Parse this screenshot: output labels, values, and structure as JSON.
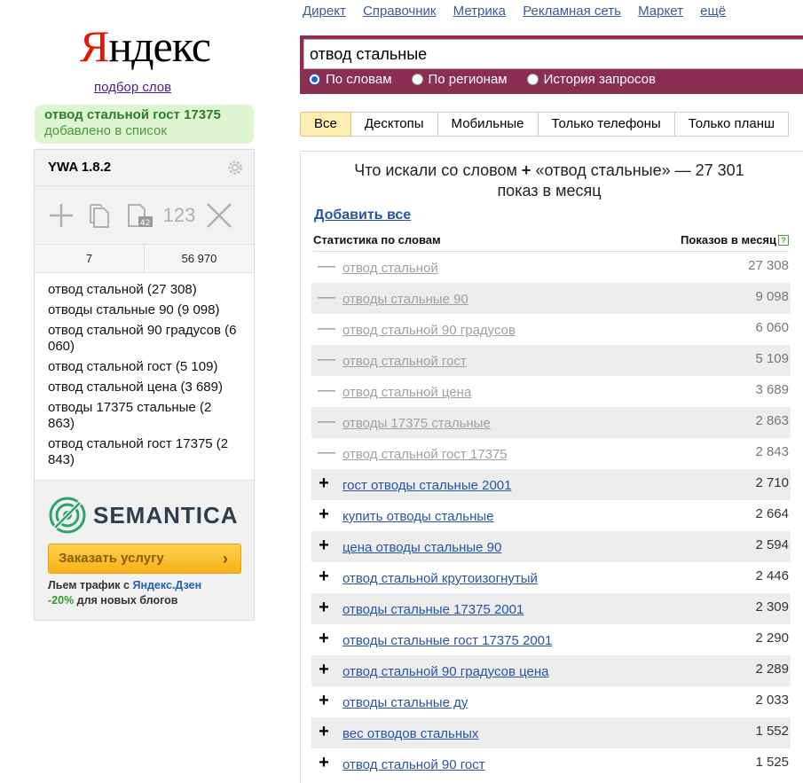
{
  "logo": {
    "first": "Я",
    "rest": "ндекс"
  },
  "podbor_link": "подбор слов",
  "added_notice": {
    "keyword": "отвод стальной гост 17375",
    "message": "добавлено в список"
  },
  "ywa": {
    "title": "YWA 1.8.2",
    "tool_123": "123",
    "counts": {
      "phrases": "7",
      "total": "56 970"
    },
    "list": [
      "отвод стальной (27 308)",
      "отводы стальные 90 (9 098)",
      "отвод стальной 90 градусов (6 060)",
      "отвод стальной гост (5 109)",
      "отвод стальной цена (3 689)",
      "отводы 17375 стальные (2 863)",
      "отвод стальной гост 17375 (2 843)"
    ],
    "promo": {
      "brand": "SEMANTICA",
      "button": "Заказать услугу",
      "note_line1_prefix": "Льем трафик с ",
      "note_line1_link": "Яндекс.Дзен",
      "note_line2_pct": "-20%",
      "note_line2_rest": " для новых блогов"
    }
  },
  "topnav": [
    "Директ",
    "Справочник",
    "Метрика",
    "Рекламная сеть",
    "Маркет",
    "ещё"
  ],
  "search": {
    "query": "отвод стальные",
    "radios": [
      {
        "label": "По словам",
        "selected": true
      },
      {
        "label": "По регионам",
        "selected": false
      },
      {
        "label": "История запросов",
        "selected": false
      }
    ]
  },
  "tabs": [
    {
      "label": "Все",
      "active": true
    },
    {
      "label": "Десктопы",
      "active": false
    },
    {
      "label": "Мобильные",
      "active": false
    },
    {
      "label": "Только телефоны",
      "active": false
    },
    {
      "label": "Только планш",
      "active": false
    }
  ],
  "panel": {
    "title_line1": "Что искали со словом",
    "title_plus": "+",
    "title_query": "«отвод стальные» — 27 301",
    "title_line2": "показ в месяц",
    "add_all": "Добавить все",
    "col_left": "Статистика по словам",
    "col_right": "Показов в месяц",
    "help": "?",
    "rows": [
      {
        "sign": "—",
        "phrase": "отвод стальной",
        "count": "27 308",
        "added": true
      },
      {
        "sign": "—",
        "phrase": "отводы стальные 90",
        "count": "9 098",
        "added": true
      },
      {
        "sign": "—",
        "phrase": "отвод стальной 90 градусов",
        "count": "6 060",
        "added": true
      },
      {
        "sign": "—",
        "phrase": "отвод стальной гост",
        "count": "5 109",
        "added": true
      },
      {
        "sign": "—",
        "phrase": "отвод стальной цена",
        "count": "3 689",
        "added": true
      },
      {
        "sign": "—",
        "phrase": "отводы 17375 стальные",
        "count": "2 863",
        "added": true
      },
      {
        "sign": "—",
        "phrase": "отвод стальной гост 17375",
        "count": "2 843",
        "added": true
      },
      {
        "sign": "+",
        "phrase": "гост отводы стальные 2001",
        "count": "2 710",
        "added": false
      },
      {
        "sign": "+",
        "phrase": "купить отводы стальные",
        "count": "2 664",
        "added": false
      },
      {
        "sign": "+",
        "phrase": "цена отводы стальные 90",
        "count": "2 594",
        "added": false
      },
      {
        "sign": "+",
        "phrase": "отвод стальной крутоизогнутый",
        "count": "2 446",
        "added": false
      },
      {
        "sign": "+",
        "phrase": "отводы стальные 17375 2001",
        "count": "2 309",
        "added": false
      },
      {
        "sign": "+",
        "phrase": "отводы стальные гост 17375 2001",
        "count": "2 290",
        "added": false
      },
      {
        "sign": "+",
        "phrase": "отвод стальной 90 градусов цена",
        "count": "2 289",
        "added": false
      },
      {
        "sign": "+",
        "phrase": "отводы стальные ду",
        "count": "2 033",
        "added": false
      },
      {
        "sign": "+",
        "phrase": "вес отводов стальных",
        "count": "1 552",
        "added": false
      },
      {
        "sign": "+",
        "phrase": "отвод стальной 90 гост",
        "count": "1 525",
        "added": false
      }
    ]
  },
  "colors": {
    "search_bar": "#8c2e52",
    "link": "#2654a5",
    "active_tab": "#fdeeb4",
    "logo_red": "#e61400"
  }
}
